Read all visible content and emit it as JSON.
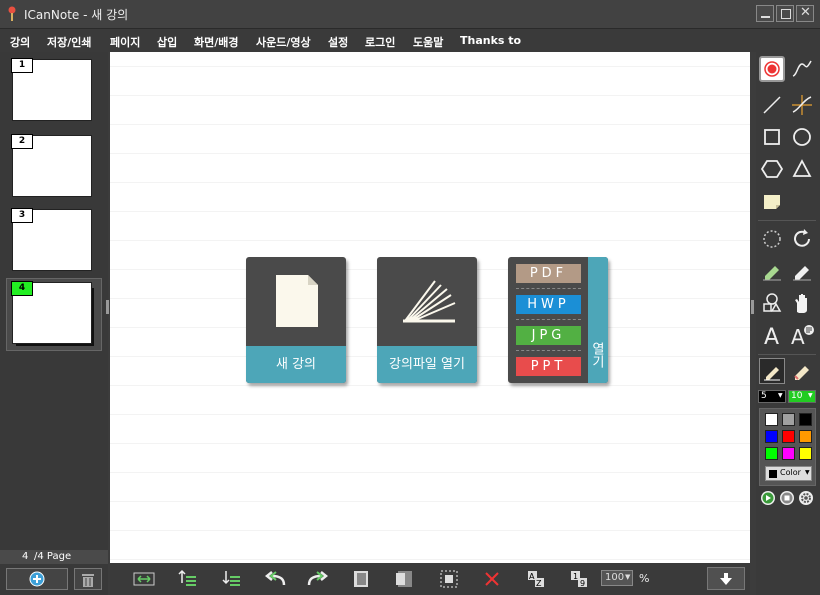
{
  "window": {
    "title": "ICanNote - 새 강의"
  },
  "menu": {
    "items": [
      "강의",
      "저장/인쇄",
      "페이지",
      "삽입",
      "화면/배경",
      "사운드/영상",
      "설정",
      "로그인",
      "도움말",
      "Thanks to"
    ]
  },
  "pages": {
    "thumbs": [
      "1",
      "2",
      "3",
      "4"
    ],
    "current": "4",
    "total_label": "/4 Page"
  },
  "cards": {
    "new_label": "새 강의",
    "open_label": "강의파일 열기",
    "formats": [
      "PDF",
      "HWP",
      "JPG",
      "PPT"
    ],
    "open_side": "열기"
  },
  "bottom": {
    "zoom": "100",
    "zoom_unit": "%"
  },
  "right": {
    "pen_size": "5",
    "pen_size2": "10",
    "color_label": "Color"
  },
  "colors": {
    "accent": "#4da6b8",
    "pdf": "#b39a86",
    "hwp": "#1b8fd6",
    "jpg": "#52b043",
    "ppt": "#e84c4c",
    "palette": [
      "#ffffff",
      "#a0a0a0",
      "#000000",
      "#0000ff",
      "#ff0000",
      "#ff9900",
      "#00ff00",
      "#ff00ff",
      "#ffff00"
    ],
    "current_page_badge": "#22ee22"
  }
}
